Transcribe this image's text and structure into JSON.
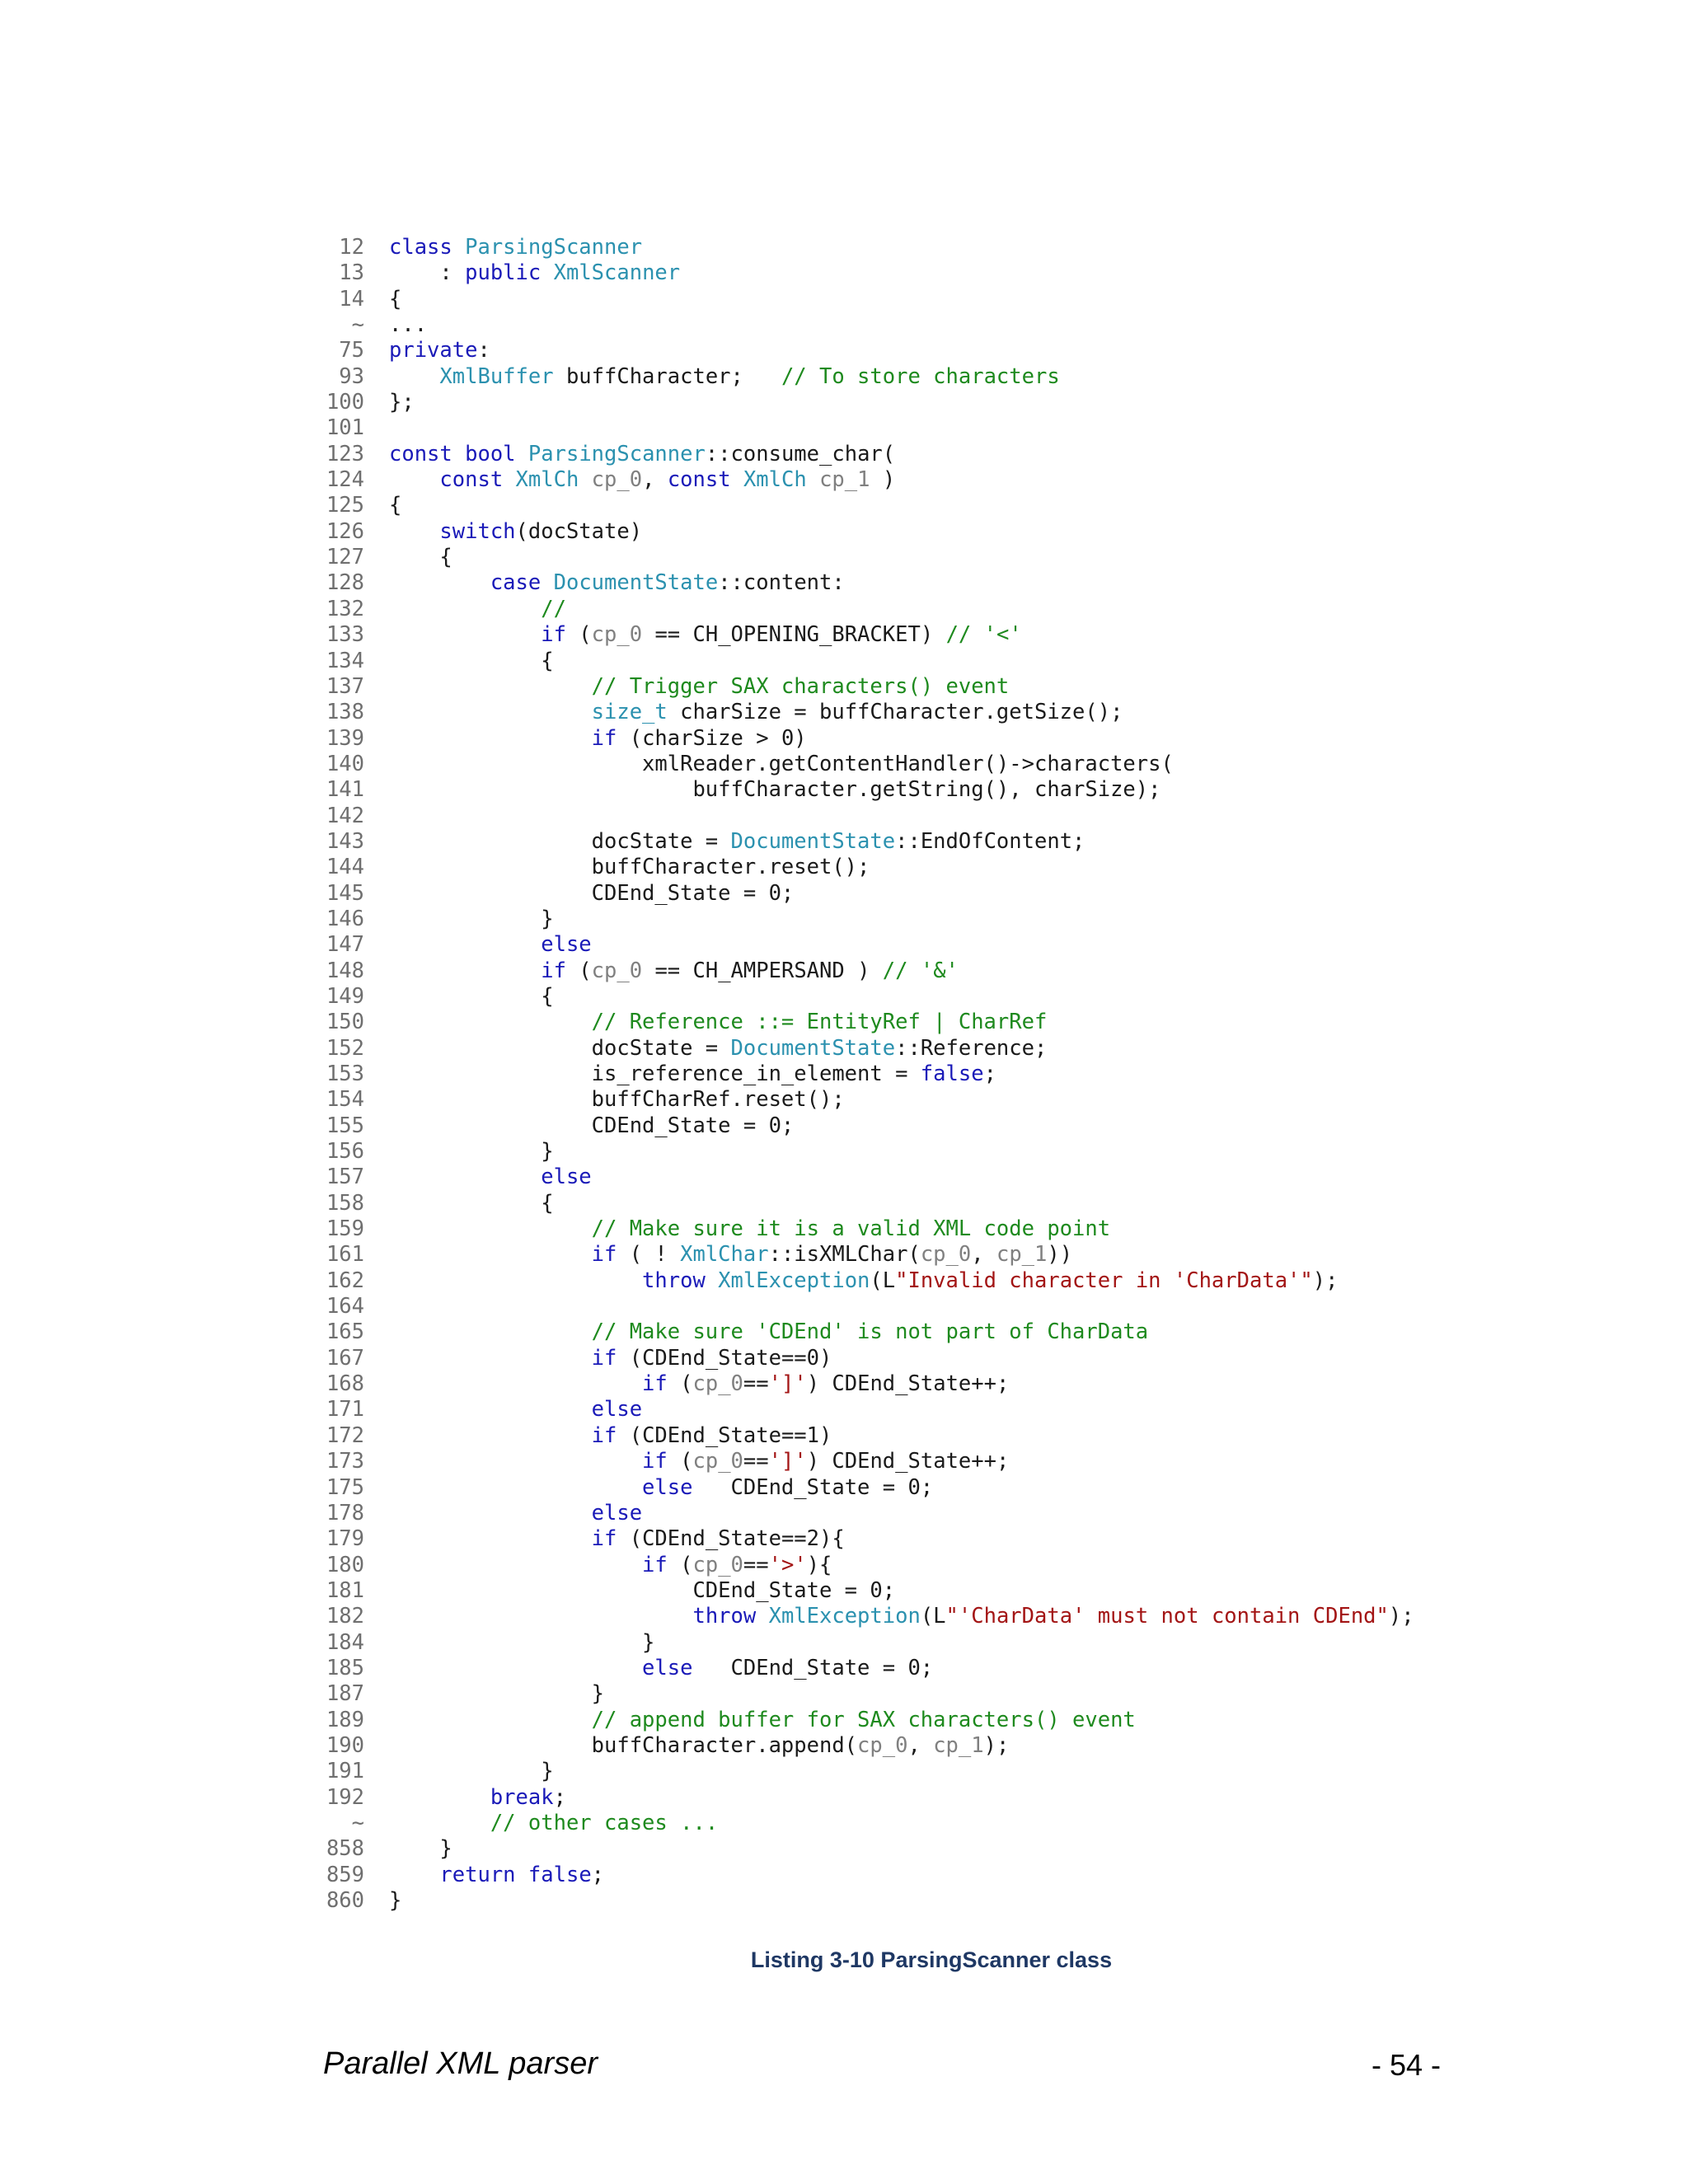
{
  "listing": {
    "lines": [
      {
        "no": "12",
        "tokens": [
          [
            "kw",
            "class"
          ],
          [
            "p",
            " "
          ],
          [
            "ty",
            "ParsingScanner"
          ]
        ]
      },
      {
        "no": "13",
        "tokens": [
          [
            "p",
            "    : "
          ],
          [
            "kw",
            "public"
          ],
          [
            "p",
            " "
          ],
          [
            "ty",
            "XmlScanner"
          ]
        ]
      },
      {
        "no": "14",
        "tokens": [
          [
            "p",
            "{"
          ]
        ]
      },
      {
        "no": "~",
        "tokens": [
          [
            "p",
            "..."
          ]
        ]
      },
      {
        "no": "75",
        "tokens": [
          [
            "kw",
            "private"
          ],
          [
            "p",
            ":"
          ]
        ]
      },
      {
        "no": "93",
        "tokens": [
          [
            "p",
            "    "
          ],
          [
            "ty",
            "XmlBuffer"
          ],
          [
            "p",
            " buffCharacter;   "
          ],
          [
            "cm",
            "// To store characters"
          ]
        ]
      },
      {
        "no": "100",
        "tokens": [
          [
            "p",
            "};"
          ]
        ]
      },
      {
        "no": "101",
        "tokens": []
      },
      {
        "no": "123",
        "tokens": [
          [
            "kw",
            "const"
          ],
          [
            "p",
            " "
          ],
          [
            "kw",
            "bool"
          ],
          [
            "p",
            " "
          ],
          [
            "ty",
            "ParsingScanner"
          ],
          [
            "p",
            "::consume_char("
          ]
        ]
      },
      {
        "no": "124",
        "tokens": [
          [
            "p",
            "    "
          ],
          [
            "kw",
            "const"
          ],
          [
            "p",
            " "
          ],
          [
            "ty",
            "XmlCh"
          ],
          [
            "p",
            " "
          ],
          [
            "pa",
            "cp_0"
          ],
          [
            "p",
            ", "
          ],
          [
            "kw",
            "const"
          ],
          [
            "p",
            " "
          ],
          [
            "ty",
            "XmlCh"
          ],
          [
            "p",
            " "
          ],
          [
            "pa",
            "cp_1"
          ],
          [
            "p",
            " )"
          ]
        ]
      },
      {
        "no": "125",
        "tokens": [
          [
            "p",
            "{"
          ]
        ]
      },
      {
        "no": "126",
        "tokens": [
          [
            "p",
            "    "
          ],
          [
            "kw",
            "switch"
          ],
          [
            "p",
            "(docState)"
          ]
        ]
      },
      {
        "no": "127",
        "tokens": [
          [
            "p",
            "    {"
          ]
        ]
      },
      {
        "no": "128",
        "tokens": [
          [
            "p",
            "        "
          ],
          [
            "kw",
            "case"
          ],
          [
            "p",
            " "
          ],
          [
            "ty",
            "DocumentState"
          ],
          [
            "p",
            "::content:"
          ]
        ]
      },
      {
        "no": "132",
        "tokens": [
          [
            "p",
            "            "
          ],
          [
            "cm",
            "//"
          ]
        ]
      },
      {
        "no": "133",
        "tokens": [
          [
            "p",
            "            "
          ],
          [
            "kw",
            "if"
          ],
          [
            "p",
            " ("
          ],
          [
            "pa",
            "cp_0"
          ],
          [
            "p",
            " == CH_OPENING_BRACKET) "
          ],
          [
            "cm",
            "// '<'"
          ]
        ]
      },
      {
        "no": "134",
        "tokens": [
          [
            "p",
            "            {"
          ]
        ]
      },
      {
        "no": "137",
        "tokens": [
          [
            "p",
            "                "
          ],
          [
            "cm",
            "// Trigger SAX characters() event"
          ]
        ]
      },
      {
        "no": "138",
        "tokens": [
          [
            "p",
            "                "
          ],
          [
            "ty",
            "size_t"
          ],
          [
            "p",
            " charSize = buffCharacter.getSize();"
          ]
        ]
      },
      {
        "no": "139",
        "tokens": [
          [
            "p",
            "                "
          ],
          [
            "kw",
            "if"
          ],
          [
            "p",
            " (charSize > 0)"
          ]
        ]
      },
      {
        "no": "140",
        "tokens": [
          [
            "p",
            "                    xmlReader.getContentHandler()->characters("
          ]
        ]
      },
      {
        "no": "141",
        "tokens": [
          [
            "p",
            "                        buffCharacter.getString(), charSize);"
          ]
        ]
      },
      {
        "no": "142",
        "tokens": []
      },
      {
        "no": "143",
        "tokens": [
          [
            "p",
            "                docState = "
          ],
          [
            "ty",
            "DocumentState"
          ],
          [
            "p",
            "::EndOfContent;"
          ]
        ]
      },
      {
        "no": "144",
        "tokens": [
          [
            "p",
            "                buffCharacter.reset();"
          ]
        ]
      },
      {
        "no": "145",
        "tokens": [
          [
            "p",
            "                CDEnd_State = 0;"
          ]
        ]
      },
      {
        "no": "146",
        "tokens": [
          [
            "p",
            "            }"
          ]
        ]
      },
      {
        "no": "147",
        "tokens": [
          [
            "p",
            "            "
          ],
          [
            "kw",
            "else"
          ]
        ]
      },
      {
        "no": "148",
        "tokens": [
          [
            "p",
            "            "
          ],
          [
            "kw",
            "if"
          ],
          [
            "p",
            " ("
          ],
          [
            "pa",
            "cp_0"
          ],
          [
            "p",
            " == CH_AMPERSAND ) "
          ],
          [
            "cm",
            "// '&'"
          ]
        ]
      },
      {
        "no": "149",
        "tokens": [
          [
            "p",
            "            {"
          ]
        ]
      },
      {
        "no": "150",
        "tokens": [
          [
            "p",
            "                "
          ],
          [
            "cm",
            "// Reference ::= EntityRef | CharRef"
          ]
        ]
      },
      {
        "no": "152",
        "tokens": [
          [
            "p",
            "                docState = "
          ],
          [
            "ty",
            "DocumentState"
          ],
          [
            "p",
            "::Reference;"
          ]
        ]
      },
      {
        "no": "153",
        "tokens": [
          [
            "p",
            "                is_reference_in_element = "
          ],
          [
            "kw",
            "false"
          ],
          [
            "p",
            ";"
          ]
        ]
      },
      {
        "no": "154",
        "tokens": [
          [
            "p",
            "                buffCharRef.reset();"
          ]
        ]
      },
      {
        "no": "155",
        "tokens": [
          [
            "p",
            "                CDEnd_State = 0;"
          ]
        ]
      },
      {
        "no": "156",
        "tokens": [
          [
            "p",
            "            }"
          ]
        ]
      },
      {
        "no": "157",
        "tokens": [
          [
            "p",
            "            "
          ],
          [
            "kw",
            "else"
          ]
        ]
      },
      {
        "no": "158",
        "tokens": [
          [
            "p",
            "            {"
          ]
        ]
      },
      {
        "no": "159",
        "tokens": [
          [
            "p",
            "                "
          ],
          [
            "cm",
            "// Make sure it is a valid XML code point"
          ]
        ]
      },
      {
        "no": "161",
        "tokens": [
          [
            "p",
            "                "
          ],
          [
            "kw",
            "if"
          ],
          [
            "p",
            " ( ! "
          ],
          [
            "ty",
            "XmlChar"
          ],
          [
            "p",
            "::isXMLChar("
          ],
          [
            "pa",
            "cp_0"
          ],
          [
            "p",
            ", "
          ],
          [
            "pa",
            "cp_1"
          ],
          [
            "p",
            "))"
          ]
        ]
      },
      {
        "no": "162",
        "tokens": [
          [
            "p",
            "                    "
          ],
          [
            "kw",
            "throw"
          ],
          [
            "p",
            " "
          ],
          [
            "ty",
            "XmlException"
          ],
          [
            "p",
            "(L"
          ],
          [
            "st",
            "\"Invalid character in 'CharData'\""
          ],
          [
            "p",
            ");"
          ]
        ]
      },
      {
        "no": "164",
        "tokens": []
      },
      {
        "no": "165",
        "tokens": [
          [
            "p",
            "                "
          ],
          [
            "cm",
            "// Make sure 'CDEnd' is not part of CharData"
          ]
        ]
      },
      {
        "no": "167",
        "tokens": [
          [
            "p",
            "                "
          ],
          [
            "kw",
            "if"
          ],
          [
            "p",
            " (CDEnd_State==0)"
          ]
        ]
      },
      {
        "no": "168",
        "tokens": [
          [
            "p",
            "                    "
          ],
          [
            "kw",
            "if"
          ],
          [
            "p",
            " ("
          ],
          [
            "pa",
            "cp_0"
          ],
          [
            "p",
            "=="
          ],
          [
            "st",
            "']'"
          ],
          [
            "p",
            ") CDEnd_State++;"
          ]
        ]
      },
      {
        "no": "171",
        "tokens": [
          [
            "p",
            "                "
          ],
          [
            "kw",
            "else"
          ]
        ]
      },
      {
        "no": "172",
        "tokens": [
          [
            "p",
            "                "
          ],
          [
            "kw",
            "if"
          ],
          [
            "p",
            " (CDEnd_State==1)"
          ]
        ]
      },
      {
        "no": "173",
        "tokens": [
          [
            "p",
            "                    "
          ],
          [
            "kw",
            "if"
          ],
          [
            "p",
            " ("
          ],
          [
            "pa",
            "cp_0"
          ],
          [
            "p",
            "=="
          ],
          [
            "st",
            "']'"
          ],
          [
            "p",
            ") CDEnd_State++;"
          ]
        ]
      },
      {
        "no": "175",
        "tokens": [
          [
            "p",
            "                    "
          ],
          [
            "kw",
            "else"
          ],
          [
            "p",
            "   CDEnd_State = 0;"
          ]
        ]
      },
      {
        "no": "178",
        "tokens": [
          [
            "p",
            "                "
          ],
          [
            "kw",
            "else"
          ]
        ]
      },
      {
        "no": "179",
        "tokens": [
          [
            "p",
            "                "
          ],
          [
            "kw",
            "if"
          ],
          [
            "p",
            " (CDEnd_State==2){"
          ]
        ]
      },
      {
        "no": "180",
        "tokens": [
          [
            "p",
            "                    "
          ],
          [
            "kw",
            "if"
          ],
          [
            "p",
            " ("
          ],
          [
            "pa",
            "cp_0"
          ],
          [
            "p",
            "=="
          ],
          [
            "st",
            "'>'"
          ],
          [
            "p",
            "){"
          ]
        ]
      },
      {
        "no": "181",
        "tokens": [
          [
            "p",
            "                        CDEnd_State = 0;"
          ]
        ]
      },
      {
        "no": "182",
        "tokens": [
          [
            "p",
            "                        "
          ],
          [
            "kw",
            "throw"
          ],
          [
            "p",
            " "
          ],
          [
            "ty",
            "XmlException"
          ],
          [
            "p",
            "(L"
          ],
          [
            "st",
            "\"'CharData' must not contain CDEnd\""
          ],
          [
            "p",
            ");"
          ]
        ]
      },
      {
        "no": "184",
        "tokens": [
          [
            "p",
            "                    }"
          ]
        ]
      },
      {
        "no": "185",
        "tokens": [
          [
            "p",
            "                    "
          ],
          [
            "kw",
            "else"
          ],
          [
            "p",
            "   CDEnd_State = 0;"
          ]
        ]
      },
      {
        "no": "187",
        "tokens": [
          [
            "p",
            "                }"
          ]
        ]
      },
      {
        "no": "189",
        "tokens": [
          [
            "p",
            "                "
          ],
          [
            "cm",
            "// append buffer for SAX characters() event"
          ]
        ]
      },
      {
        "no": "190",
        "tokens": [
          [
            "p",
            "                buffCharacter.append("
          ],
          [
            "pa",
            "cp_0"
          ],
          [
            "p",
            ", "
          ],
          [
            "pa",
            "cp_1"
          ],
          [
            "p",
            ");"
          ]
        ]
      },
      {
        "no": "191",
        "tokens": [
          [
            "p",
            "            }"
          ]
        ]
      },
      {
        "no": "192",
        "tokens": [
          [
            "p",
            "        "
          ],
          [
            "kw",
            "break"
          ],
          [
            "p",
            ";"
          ]
        ]
      },
      {
        "no": "~",
        "tokens": [
          [
            "p",
            "        "
          ],
          [
            "cm",
            "// other cases ..."
          ]
        ]
      },
      {
        "no": "858",
        "tokens": [
          [
            "p",
            "    }"
          ]
        ]
      },
      {
        "no": "859",
        "tokens": [
          [
            "p",
            "    "
          ],
          [
            "kw",
            "return"
          ],
          [
            "p",
            " "
          ],
          [
            "kw",
            "false"
          ],
          [
            "p",
            ";"
          ]
        ]
      },
      {
        "no": "860",
        "tokens": [
          [
            "p",
            "}"
          ]
        ]
      }
    ]
  },
  "caption": "Listing 3-10 ParsingScanner class",
  "footer": {
    "title": "Parallel XML parser",
    "page": "- 54 -"
  }
}
